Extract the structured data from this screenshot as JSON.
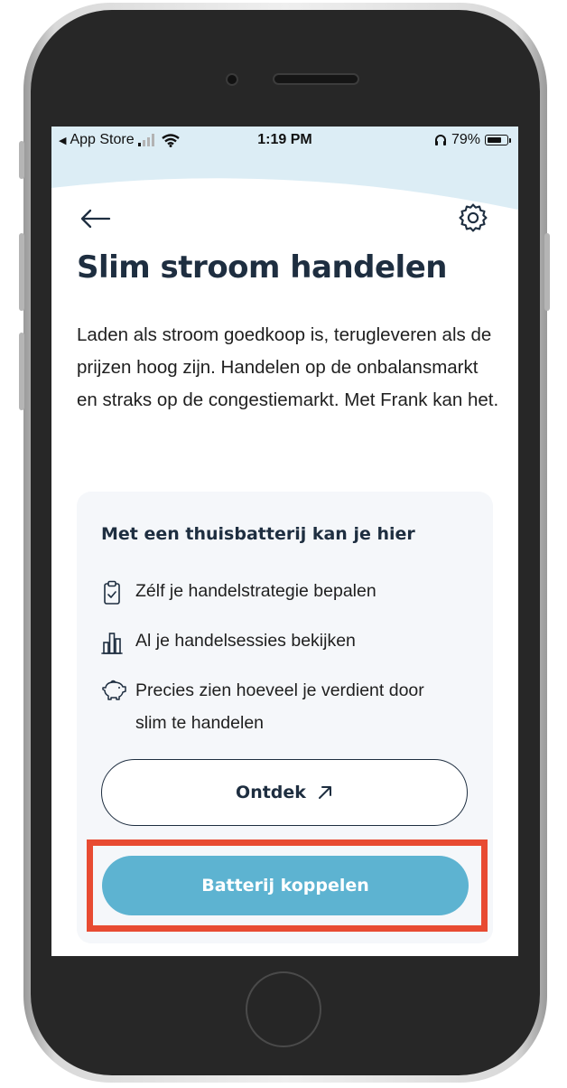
{
  "status_bar": {
    "back_app": "App Store",
    "time": "1:19 PM",
    "battery_percent": "79%",
    "battery_level": 0.79
  },
  "header": {
    "back_icon": "arrow-left-icon",
    "settings_icon": "gear-icon"
  },
  "page": {
    "title": "Slim stroom handelen",
    "intro": "Laden als stroom goedkoop is, terugleveren als de prijzen hoog zijn. Handelen op de onbalansmarkt en straks op de congestiemarkt. Met Frank kan het."
  },
  "card": {
    "title": "Met een thuisbatterij kan je hier",
    "features": [
      {
        "icon": "clipboard-check-icon",
        "text": "Zélf je handelstrategie bepalen"
      },
      {
        "icon": "bar-chart-icon",
        "text": "Al je handelsessies bekijken"
      },
      {
        "icon": "piggy-bank-icon",
        "text": "Precies zien hoeveel je verdient door slim te handelen"
      }
    ],
    "discover_button": "Ontdek",
    "discover_icon": "arrow-up-right-icon",
    "connect_button": "Batterij koppelen"
  },
  "colors": {
    "primary_text": "#1e2e40",
    "accent_button": "#5db3d1",
    "header_wave": "#dcedf5",
    "highlight": "#e84b32",
    "card_bg": "#f5f7fa"
  }
}
